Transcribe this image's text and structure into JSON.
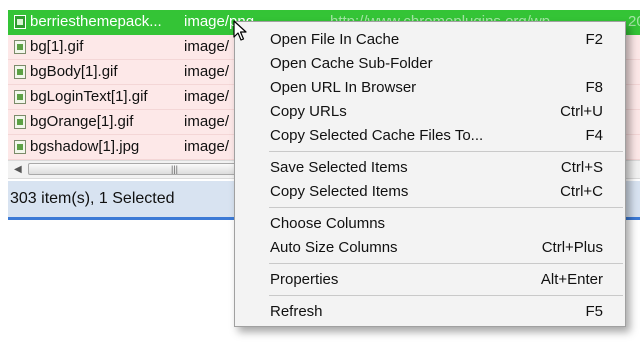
{
  "file_list": {
    "rows": [
      {
        "name": "berriesthemepack...",
        "type": "image/png",
        "url": "http://www.chromeplugins.org/wp...",
        "extra": "20",
        "selected": true,
        "icon": "image-file-icon"
      },
      {
        "name": "bg[1].gif",
        "type": "image/",
        "selected": false,
        "icon": "image-file-icon"
      },
      {
        "name": "bgBody[1].gif",
        "type": "image/",
        "selected": false,
        "icon": "image-file-icon"
      },
      {
        "name": "bgLoginText[1].gif",
        "type": "image/",
        "selected": false,
        "icon": "image-file-icon"
      },
      {
        "name": "bgOrange[1].gif",
        "type": "image/",
        "selected": false,
        "icon": "image-file-icon"
      },
      {
        "name": "bgshadow[1].jpg",
        "type": "image/",
        "selected": false,
        "icon": "image-file-icon"
      }
    ]
  },
  "status_bar": {
    "text": "303 item(s), 1 Selected"
  },
  "context_menu": {
    "items": [
      {
        "label": "Open File In Cache",
        "shortcut": "F2"
      },
      {
        "label": "Open Cache Sub-Folder",
        "shortcut": ""
      },
      {
        "label": "Open URL In Browser",
        "shortcut": "F8"
      },
      {
        "label": "Copy URLs",
        "shortcut": "Ctrl+U"
      },
      {
        "label": "Copy Selected Cache Files To...",
        "shortcut": "F4"
      },
      {
        "label": "Save Selected Items",
        "shortcut": "Ctrl+S"
      },
      {
        "label": "Copy Selected Items",
        "shortcut": "Ctrl+C"
      },
      {
        "label": "Choose Columns",
        "shortcut": ""
      },
      {
        "label": "Auto Size Columns",
        "shortcut": "Ctrl+Plus"
      },
      {
        "label": "Properties",
        "shortcut": "Alt+Enter"
      },
      {
        "label": "Refresh",
        "shortcut": "F5"
      }
    ]
  },
  "colors": {
    "selection": "#34c436",
    "row_background": "#fde8e8",
    "status_background": "#d8e3f1",
    "menu_background": "#f3f3f3"
  }
}
